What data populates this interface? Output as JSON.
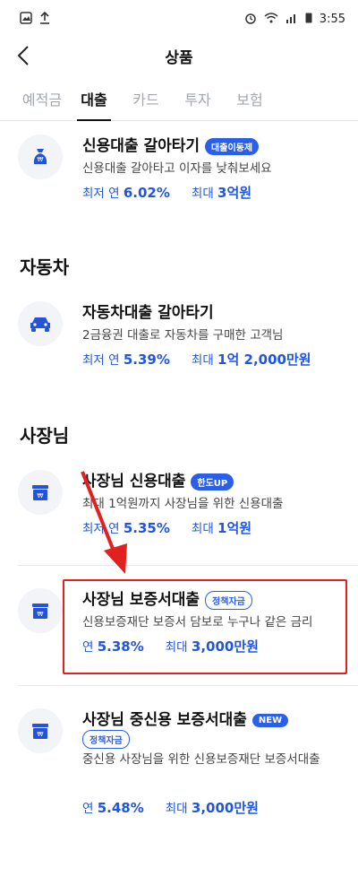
{
  "status_bar": {
    "time": "3:55"
  },
  "header": {
    "title": "상품"
  },
  "tabs": [
    {
      "label": "예적금"
    },
    {
      "label": "대출"
    },
    {
      "label": "카드"
    },
    {
      "label": "투자"
    },
    {
      "label": "보험"
    }
  ],
  "products": {
    "credit_refi": {
      "title": "신용대출 갈아타기",
      "badge": "대출이동제",
      "desc": "신용대출 갈아타고 이자를 낮춰보세요",
      "rate_label": "최저 연",
      "rate": "6.02%",
      "limit_label": "최대",
      "limit": "3억원"
    },
    "auto_refi": {
      "title": "자동차대출 갈아타기",
      "desc": "2금융권 대출로 자동차를 구매한 고객님",
      "rate_label": "최저 연",
      "rate": "5.39%",
      "limit_label": "최대",
      "limit": "1억 2,000만원"
    },
    "biz_credit": {
      "title": "사장님 신용대출",
      "badge": "한도UP",
      "desc": "최대 1억원까지 사장님을 위한 신용대출",
      "rate_label": "최저 연",
      "rate": "5.35%",
      "limit_label": "최대",
      "limit": "1억원"
    },
    "biz_guarantee": {
      "title": "사장님 보증서대출",
      "badge": "정책자금",
      "desc": "신용보증재단 보증서 담보로 누구나 같은 금리",
      "rate_label": "연",
      "rate": "5.38%",
      "limit_label": "최대",
      "limit": "3,000만원"
    },
    "biz_midcredit": {
      "title": "사장님 중신용 보증서대출",
      "badge": "NEW",
      "badge2": "정책자금",
      "desc": "중신용 사장님을 위한 신용보증재단 보증서대출",
      "rate_label": "연",
      "rate": "5.48%",
      "limit_label": "최대",
      "limit": "3,000만원"
    }
  },
  "sections": {
    "auto": "자동차",
    "boss": "사장님"
  },
  "colors": {
    "accent": "#2a5fe8",
    "highlight": "#e32020"
  }
}
